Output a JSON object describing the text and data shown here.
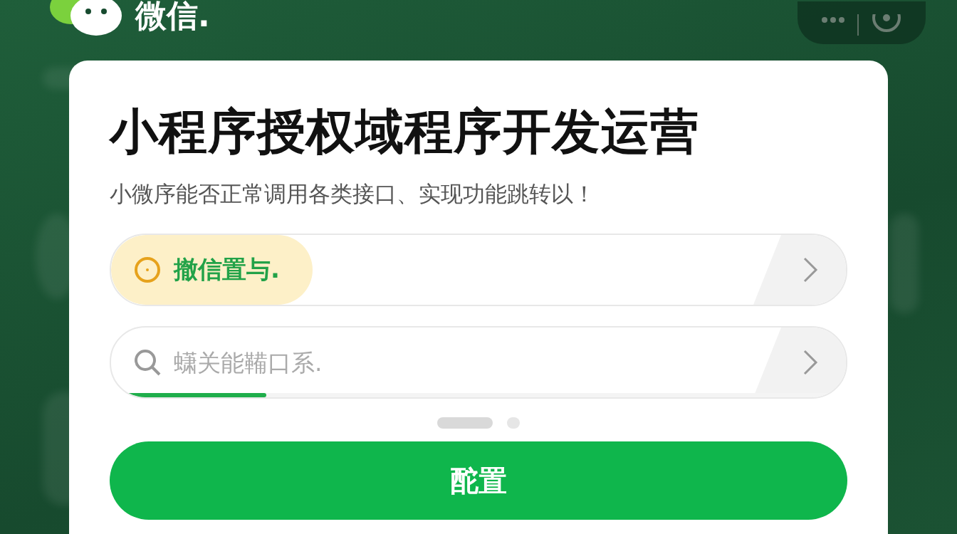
{
  "app_header": {
    "title": "微信."
  },
  "card": {
    "title": "小程序授权域程序开发运营",
    "subtitle": "小微序能否正常调用各类接口、实现功能跳转以！",
    "rows": [
      {
        "kind": "highlight",
        "label": "撤信置与."
      },
      {
        "kind": "search",
        "placeholder": "蟏关能鞴口系.",
        "level": 0.2
      }
    ],
    "pager": [
      {
        "selected": true
      },
      {
        "selected": false
      }
    ],
    "button": "酡置"
  }
}
